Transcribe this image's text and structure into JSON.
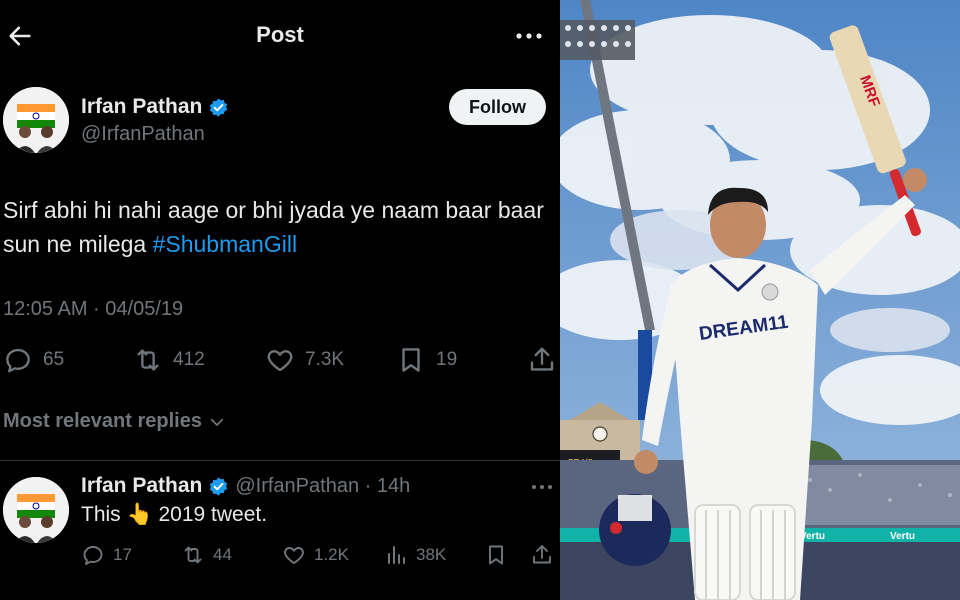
{
  "topbar": {
    "title": "Post"
  },
  "post": {
    "author_name": "Irfan Pathan",
    "handle": "@IrfanPathan",
    "follow_label": "Follow",
    "text_plain": "Sirf abhi hi nahi aage or bhi jyada ye naam baar baar sun ne milega ",
    "hashtag": "#ShubmanGill",
    "timestamp": "12:05 AM · 04/05/19",
    "replies": "65",
    "reposts": "412",
    "likes": "7.3K",
    "bookmarks": "19"
  },
  "replies_filter": {
    "label": "Most relevant replies"
  },
  "reply": {
    "author_name": "Irfan Pathan",
    "meta": "@IrfanPathan · 14h",
    "text": "This 👆 2019 tweet.",
    "replies": "17",
    "reposts": "44",
    "likes": "1.2K",
    "views": "38K"
  },
  "photo": {
    "bat_brand": "MRF",
    "jersey_sponsor": "DREAM11",
    "board_sponsor": "Vertu",
    "scoreboard": "574/8"
  },
  "colors": {
    "accent": "#1d9bf0",
    "text": "#e7e9ea",
    "muted": "#71767b",
    "background": "#000000"
  },
  "icons": [
    "back-arrow-icon",
    "more-icon",
    "verified-icon",
    "reply-icon",
    "repost-icon",
    "like-icon",
    "bookmark-icon",
    "share-icon",
    "views-icon",
    "chevron-down-icon"
  ]
}
